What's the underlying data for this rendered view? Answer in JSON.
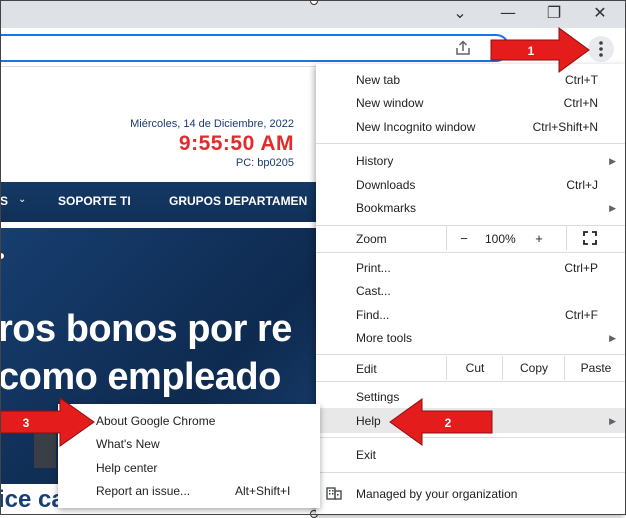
{
  "window": {
    "controls": {
      "minimize": "chevron-down-icon",
      "restore": "restore-icon",
      "close": "close-icon"
    }
  },
  "webpage": {
    "date": "Miércoles, 14 de Diciembre, 2022",
    "time": "9:55:50 AM",
    "pc": "PC: bp0205",
    "nav": [
      "S",
      "SOPORTE TI",
      "GRUPOS DEPARTAMEN"
    ],
    "hero_lines": [
      "ros bonos por re",
      "como empleado",
      "ice candidate"
    ]
  },
  "menu": {
    "new_tab": "New tab",
    "new_tab_sc": "Ctrl+T",
    "new_window": "New window",
    "new_window_sc": "Ctrl+N",
    "new_incognito": "New Incognito window",
    "new_incognito_sc": "Ctrl+Shift+N",
    "history": "History",
    "downloads": "Downloads",
    "downloads_sc": "Ctrl+J",
    "bookmarks": "Bookmarks",
    "zoom": "Zoom",
    "zoom_minus": "−",
    "zoom_value": "100%",
    "zoom_plus": "+",
    "print": "Print...",
    "print_sc": "Ctrl+P",
    "cast": "Cast...",
    "find": "Find...",
    "find_sc": "Ctrl+F",
    "more_tools": "More tools",
    "edit": "Edit",
    "cut": "Cut",
    "copy": "Copy",
    "paste": "Paste",
    "settings": "Settings",
    "help": "Help",
    "exit": "Exit",
    "managed": "Managed by your organization"
  },
  "help_submenu": {
    "about": "About Google Chrome",
    "whats_new": "What's New",
    "help_center": "Help center",
    "report": "Report an issue...",
    "report_sc": "Alt+Shift+I"
  },
  "annotations": {
    "arrow1": "1",
    "arrow2": "2",
    "arrow3": "3"
  },
  "colors": {
    "arrow_red": "#e51c1c",
    "clock_red": "#e32b2b",
    "nav_blue": "#153a66",
    "omnibox_blue": "#1a73e8"
  }
}
